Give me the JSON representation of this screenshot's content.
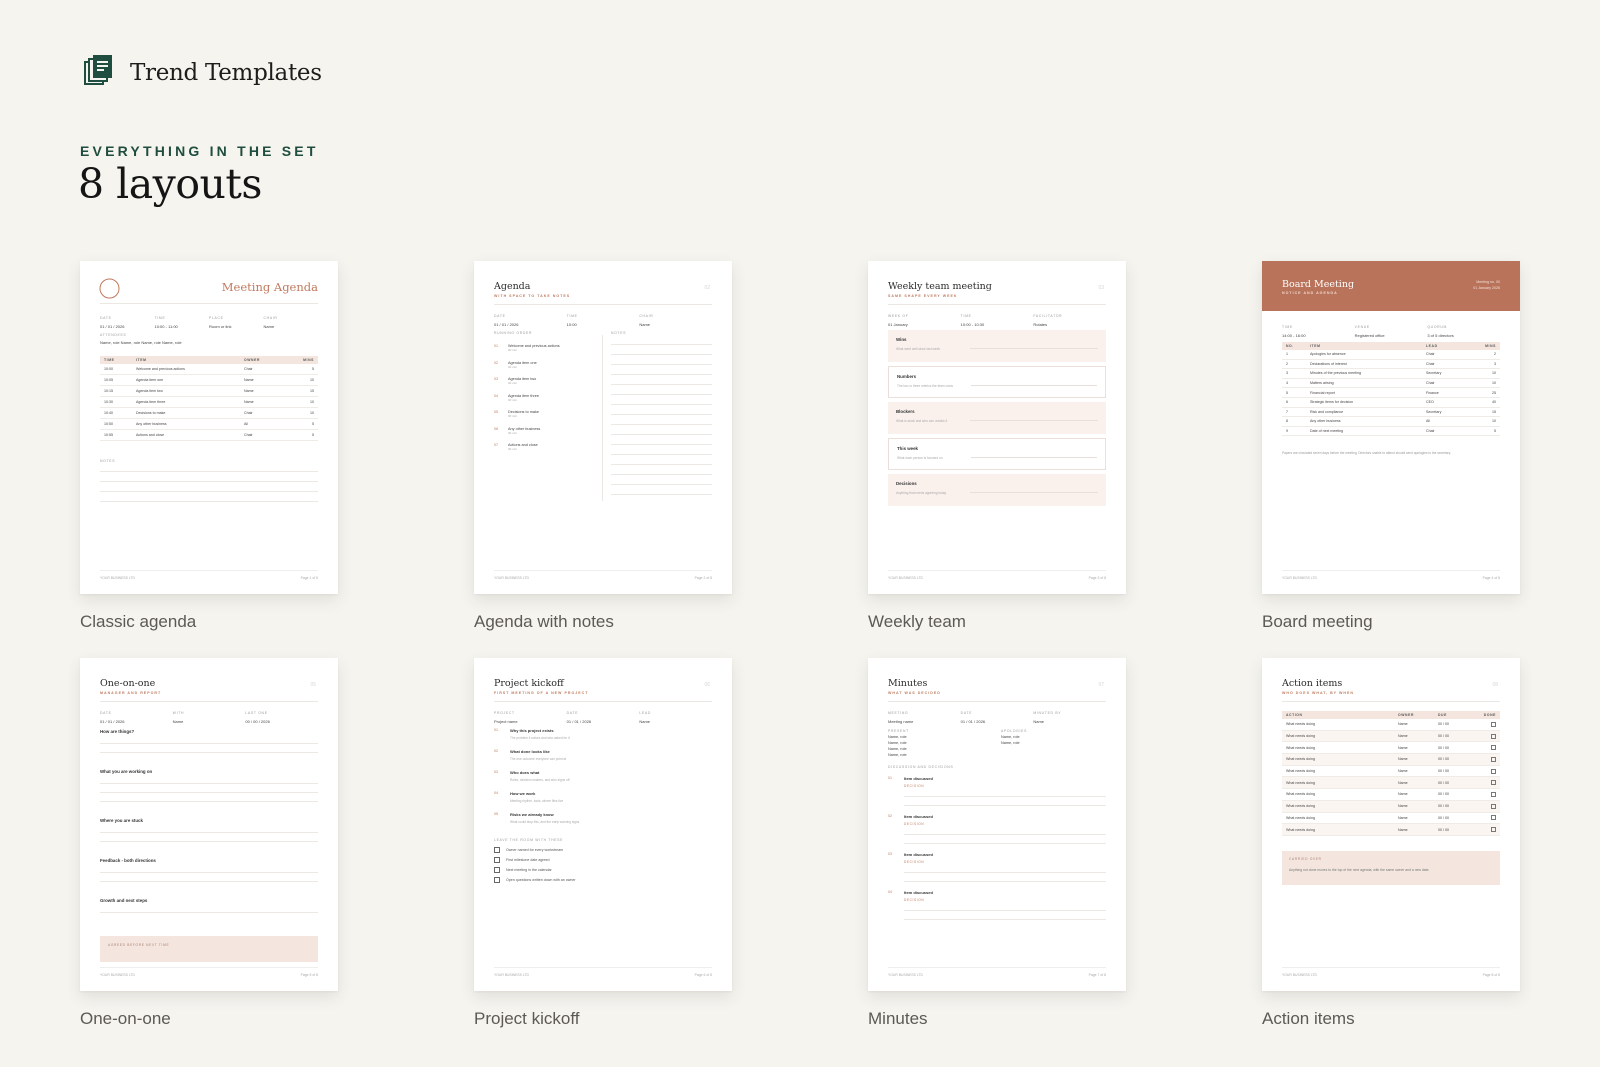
{
  "brand": {
    "name": "Trend Templates",
    "icon": "stacked-document-icon",
    "accent": "#1f4d3f"
  },
  "section": {
    "eyebrow": "EVERYTHING IN THE SET",
    "title": "8 layouts"
  },
  "colors": {
    "background": "#f5f4ef",
    "terracotta": "#b8735a",
    "blush": "#f4e6df"
  },
  "templates": [
    {
      "caption": "Classic agenda"
    },
    {
      "caption": "Agenda with notes"
    },
    {
      "caption": "Weekly team"
    },
    {
      "caption": "Board meeting"
    },
    {
      "caption": "One-on-one"
    },
    {
      "caption": "Project kickoff"
    },
    {
      "caption": "Minutes"
    },
    {
      "caption": "Action items"
    }
  ],
  "previews": {
    "footer_left": "YOUR BUSINESS LTD",
    "classic": {
      "title": "Meeting Agenda",
      "meta": [
        {
          "k": "DATE",
          "v": "01 / 01 / 2026"
        },
        {
          "k": "TIME",
          "v": "10:00 - 11:00"
        },
        {
          "k": "PLACE",
          "v": "Room or link"
        },
        {
          "k": "CHAIR",
          "v": "Name"
        }
      ],
      "attendees_label": "ATTENDEES",
      "attendees": "Name, role   Name, role   Name, role   Name, role",
      "headers": [
        "TIME",
        "ITEM",
        "OWNER",
        "MINS"
      ],
      "rows": [
        [
          "10:00",
          "Welcome and previous actions",
          "Chair",
          "5"
        ],
        [
          "10:05",
          "Agenda item one",
          "Name",
          "10"
        ],
        [
          "10:15",
          "Agenda item two",
          "Name",
          "15"
        ],
        [
          "10:30",
          "Agenda item three",
          "Name",
          "10"
        ],
        [
          "10:40",
          "Decisions to make",
          "Chair",
          "10"
        ],
        [
          "10:50",
          "Any other business",
          "All",
          "5"
        ],
        [
          "10:55",
          "Actions and close",
          "Chair",
          "5"
        ]
      ],
      "notes_label": "NOTES",
      "page": "Page 1 of 8"
    },
    "notes": {
      "title": "Agenda",
      "sub": "WITH SPACE TO TAKE NOTES",
      "meta": [
        {
          "k": "DATE",
          "v": "01 / 01 / 2026"
        },
        {
          "k": "TIME",
          "v": "10:00"
        },
        {
          "k": "CHAIR",
          "v": "Name"
        }
      ],
      "order_label": "RUNNING ORDER",
      "notes_label": "NOTES",
      "items": [
        "Welcome and previous actions",
        "Agenda item one",
        "Agenda item two",
        "Agenda item three",
        "Decisions to make",
        "Any other business",
        "Actions and close"
      ],
      "item_sub": "00 min",
      "nums": [
        "01",
        "02",
        "03",
        "04",
        "05",
        "06",
        "07"
      ],
      "page": "Page 2 of 8"
    },
    "weekly": {
      "title": "Weekly team meeting",
      "sub": "SAME SHAPE EVERY WEEK",
      "meta": [
        {
          "k": "WEEK OF",
          "v": "01 January"
        },
        {
          "k": "TIME",
          "v": "10:00 - 10:30"
        },
        {
          "k": "FACILITATOR",
          "v": "Rotates"
        }
      ],
      "boxes": [
        {
          "t": "Wins",
          "s": "What went well since last week"
        },
        {
          "t": "Numbers",
          "s": "The two or three metrics the team owns"
        },
        {
          "t": "Blockers",
          "s": "What is stuck and who can unstick it"
        },
        {
          "t": "This week",
          "s": "What each person is focused on"
        },
        {
          "t": "Decisions",
          "s": "Anything that needs agreeing today"
        }
      ],
      "page": "Page 3 of 8"
    },
    "board": {
      "title": "Board Meeting",
      "sub": "NOTICE AND AGENDA",
      "right1": "Meeting no. 00",
      "right2": "01 January 2026",
      "meta": [
        {
          "k": "TIME",
          "v": "14:00 - 16:00"
        },
        {
          "k": "VENUE",
          "v": "Registered office"
        },
        {
          "k": "QUORUM",
          "v": "3 of 5 directors"
        }
      ],
      "headers": [
        "NO.",
        "ITEM",
        "LEAD",
        "MINS"
      ],
      "rows": [
        [
          "1",
          "Apologies for absence",
          "Chair",
          "2"
        ],
        [
          "2",
          "Declarations of interest",
          "Chair",
          "3"
        ],
        [
          "3",
          "Minutes of the previous meeting",
          "Secretary",
          "10"
        ],
        [
          "4",
          "Matters arising",
          "Chair",
          "10"
        ],
        [
          "5",
          "Financial report",
          "Finance",
          "25"
        ],
        [
          "6",
          "Strategic items for decision",
          "CEO",
          "40"
        ],
        [
          "7",
          "Risk and compliance",
          "Secretary",
          "15"
        ],
        [
          "8",
          "Any other business",
          "All",
          "10"
        ],
        [
          "9",
          "Date of next meeting",
          "Chair",
          "5"
        ]
      ],
      "note": "Papers are circulated seven days before the meeting. Directors unable to attend should send apologies to the secretary.",
      "page": "Page 4 of 8"
    },
    "oneonone": {
      "title": "One-on-one",
      "sub": "MANAGER AND REPORT",
      "meta": [
        {
          "k": "DATE",
          "v": "01 / 01 / 2026"
        },
        {
          "k": "WITH",
          "v": "Name"
        },
        {
          "k": "LAST ONE",
          "v": "00 / 00 / 2026"
        }
      ],
      "questions": [
        "How are things?",
        "What you are working on",
        "Where you are stuck",
        "Feedback - both directions",
        "Growth and next steps"
      ],
      "agreed": "AGREED BEFORE NEXT TIME",
      "page": "Page 5 of 8"
    },
    "kickoff": {
      "title": "Project kickoff",
      "sub": "FIRST MEETING OF A NEW PROJECT",
      "meta": [
        {
          "k": "PROJECT",
          "v": "Project name"
        },
        {
          "k": "DATE",
          "v": "01 / 01 / 2026"
        },
        {
          "k": "LEAD",
          "v": "Name"
        }
      ],
      "items": [
        {
          "n": "01",
          "t": "Why this project exists",
          "s": "The problem it solves and who asked for it"
        },
        {
          "n": "02",
          "t": "What done looks like",
          "s": "The one outcome everyone can point at"
        },
        {
          "n": "03",
          "t": "Who does what",
          "s": "Roles, decision makers, and who signs off"
        },
        {
          "n": "04",
          "t": "How we work",
          "s": "Meeting rhythm, tools, where files live"
        },
        {
          "n": "05",
          "t": "Risks we already know",
          "s": "What could stop this, and the early warning signs"
        }
      ],
      "checklist_label": "LEAVE THE ROOM WITH THESE",
      "checklist": [
        "Owner named for every workstream",
        "First milestone date agreed",
        "Next meeting in the calendar",
        "Open questions written down with an owner"
      ],
      "page": "Page 6 of 8"
    },
    "minutes": {
      "title": "Minutes",
      "sub": "WHAT WAS DECIDED",
      "meta": [
        {
          "k": "MEETING",
          "v": "Meeting name"
        },
        {
          "k": "DATE",
          "v": "01 / 01 / 2026"
        },
        {
          "k": "MINUTED BY",
          "v": "Name"
        }
      ],
      "present_label": "PRESENT",
      "present": [
        "Name, role",
        "Name, role",
        "Name, role",
        "Name, role"
      ],
      "apologies_label": "APOLOGIES",
      "apologies": [
        "Name, role",
        "Name, role"
      ],
      "discussion_label": "DISCUSSION AND DECISIONS",
      "items": [
        {
          "n": "01",
          "t": "Item discussed",
          "s": "DECISION"
        },
        {
          "n": "02",
          "t": "Item discussed",
          "s": "DECISION"
        },
        {
          "n": "03",
          "t": "Item discussed",
          "s": "DECISION"
        },
        {
          "n": "04",
          "t": "Item discussed",
          "s": "DECISION"
        }
      ],
      "page": "Page 7 of 8"
    },
    "actions": {
      "title": "Action items",
      "sub": "WHO DOES WHAT, BY WHEN",
      "headers": [
        "ACTION",
        "OWNER",
        "DUE",
        "DONE"
      ],
      "row": [
        "What needs doing",
        "Name",
        "00 / 00"
      ],
      "rows_count_label": "10",
      "carry_label": "CARRIED OVER",
      "carry_text": "Anything not done moves to the top of the next agenda, with the same owner and a new date.",
      "page": "Page 8 of 8"
    }
  }
}
